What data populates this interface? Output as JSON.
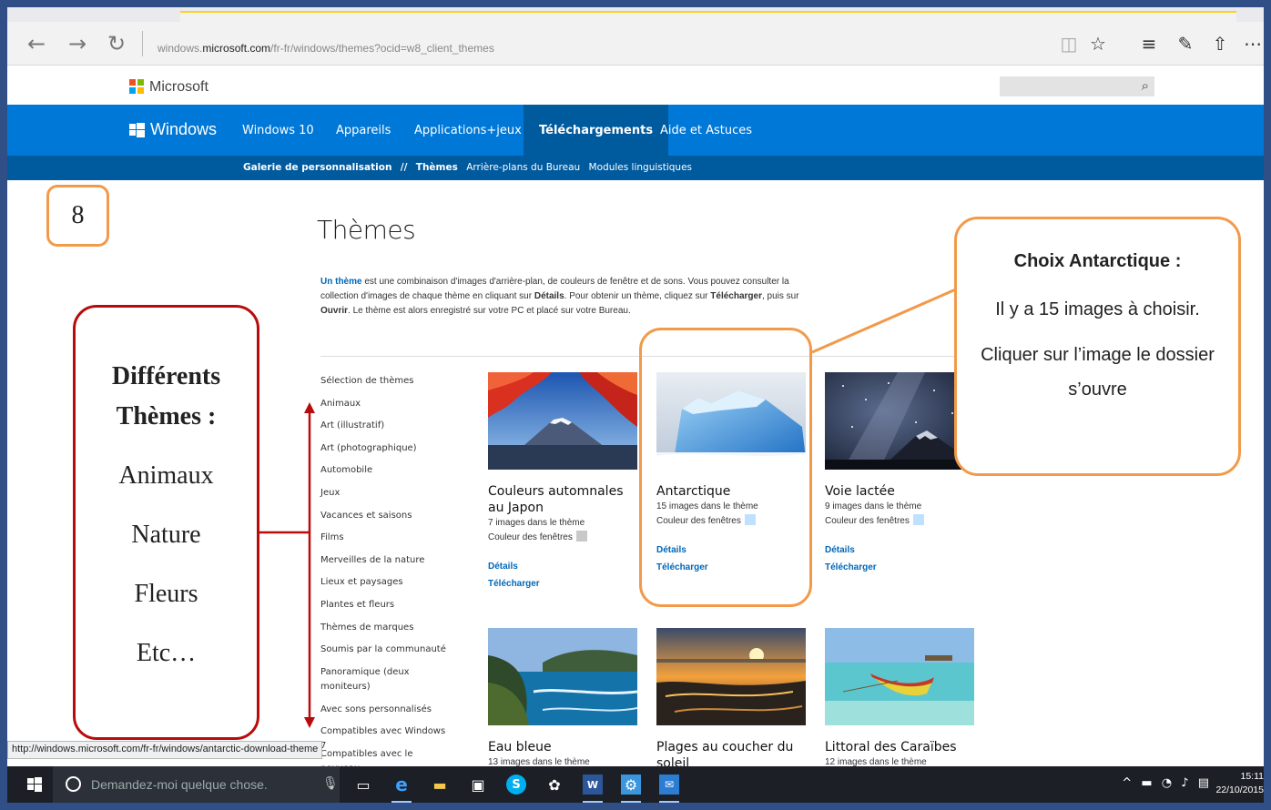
{
  "browser": {
    "url_prefix": "windows.",
    "url_domain": "microsoft.com",
    "url_path": "/fr-fr/windows/themes?ocid=w8_client_themes",
    "status_url": "http://windows.microsoft.com/fr-fr/windows/antarctic-download-theme"
  },
  "header": {
    "brand": "Microsoft"
  },
  "nav": {
    "brand": "Windows",
    "items": [
      "Windows 10",
      "Appareils",
      "Applications+jeux",
      "Téléchargements",
      "Aide et Astuces"
    ],
    "active": "Téléchargements"
  },
  "subnav": {
    "gallery": "Galerie de personnalisation",
    "sep": "//",
    "themes": "Thèmes",
    "wallpapers": "Arrière-plans du Bureau",
    "languages": "Modules linguistiques"
  },
  "page": {
    "title": "Thèmes",
    "intro": {
      "link": "Un thème",
      "p1": " est une combinaison d'images d'arrière-plan, de couleurs de fenêtre et de sons. Vous pouvez consulter la collection d'images de chaque thème en cliquant sur ",
      "details": "Détails",
      "p2": ". Pour obtenir un thème, cliquez sur ",
      "download": "Télécharger",
      "p3": ", puis sur ",
      "open": "Ouvrir",
      "p4": ". Le thème est alors enregistré sur votre PC et placé sur votre Bureau."
    }
  },
  "categories": [
    "Sélection de thèmes",
    "Animaux",
    "Art (illustratif)",
    "Art (photographique)",
    "Automobile",
    "Jeux",
    "Vacances et saisons",
    "Films",
    "Merveilles de la nature",
    "Lieux et paysages",
    "Plantes et fleurs",
    "Thèmes de marques",
    "Soumis par la communauté",
    "Panoramique (deux moniteurs)",
    "Avec sons personnalisés",
    "Compatibles avec Windows 7",
    "Compatibles avec le nouveau"
  ],
  "themes": [
    {
      "title": "Couleurs automnales au Japon",
      "count": "7 images dans le thème",
      "color_label": "Couleur des fenêtres",
      "color": "#c8c8c8",
      "details": "Détails",
      "download": "Télécharger"
    },
    {
      "title": "Antarctique",
      "count": "15 images dans le thème",
      "color_label": "Couleur des fenêtres",
      "color": "#bfe0ff",
      "details": "Détails",
      "download": "Télécharger"
    },
    {
      "title": "Voie lactée",
      "count": "9 images dans le thème",
      "color_label": "Couleur des fenêtres",
      "color": "#bfe0ff",
      "details": "Détails",
      "download": "Télécharger"
    },
    {
      "title": "Eau bleue",
      "count": "13 images dans le thème"
    },
    {
      "title": "Plages au coucher du soleil"
    },
    {
      "title": "Littoral des Caraïbes",
      "count": "12 images dans le thème"
    }
  ],
  "annotations": {
    "step": "8",
    "left_heading": "Différents Thèmes :",
    "left_items": [
      "Animaux",
      "Nature",
      "Fleurs",
      "Etc…"
    ],
    "right_heading": "Choix Antarctique :",
    "right_p1": "Il y a 15 images à choisir.",
    "right_p2": "Cliquer sur l’image le dossier s’ouvre"
  },
  "taskbar": {
    "search_placeholder": "Demandez-moi quelque chose.",
    "time": "15:11",
    "date": "22/10/2015"
  },
  "colors": {
    "frame": "#2f4f86",
    "nav_blue": "#0078d7",
    "nav_dark": "#005a9e",
    "link": "#0067b8",
    "annotation_orange": "#f29a4a",
    "annotation_red": "#b80c0c"
  }
}
